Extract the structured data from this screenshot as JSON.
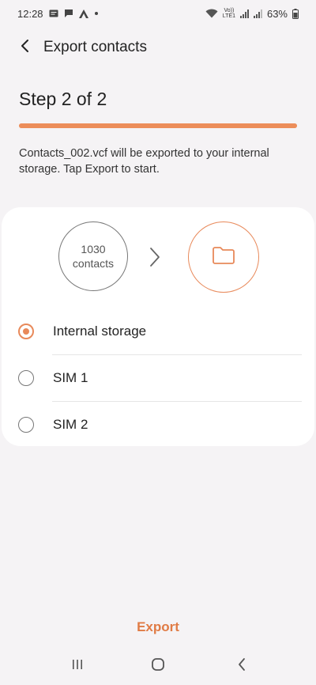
{
  "status_bar": {
    "time": "12:28",
    "network_top": "Vo))",
    "network_bottom": "LTE1",
    "battery": "63%"
  },
  "header": {
    "title": "Export contacts"
  },
  "step": {
    "title": "Step 2 of 2",
    "progress": 1.0
  },
  "info": {
    "text": "Contacts_002.vcf will be exported to your internal storage. Tap Export to start."
  },
  "summary": {
    "count": "1030",
    "count_label": "contacts"
  },
  "options": [
    {
      "label": "Internal storage",
      "selected": true
    },
    {
      "label": "SIM 1",
      "selected": false
    },
    {
      "label": "SIM 2",
      "selected": false
    }
  ],
  "actions": {
    "export_label": "Export"
  },
  "colors": {
    "accent": "#e8895a",
    "accent_text": "#e07b45",
    "progress_track": "#f3c7ac",
    "background": "#f5f3f5"
  },
  "icons": {
    "back": "back-arrow-icon",
    "arrow": "chevron-right-icon",
    "folder": "folder-icon",
    "nav_recents": "recent-apps-icon",
    "nav_home": "home-icon",
    "nav_back": "nav-back-icon"
  }
}
